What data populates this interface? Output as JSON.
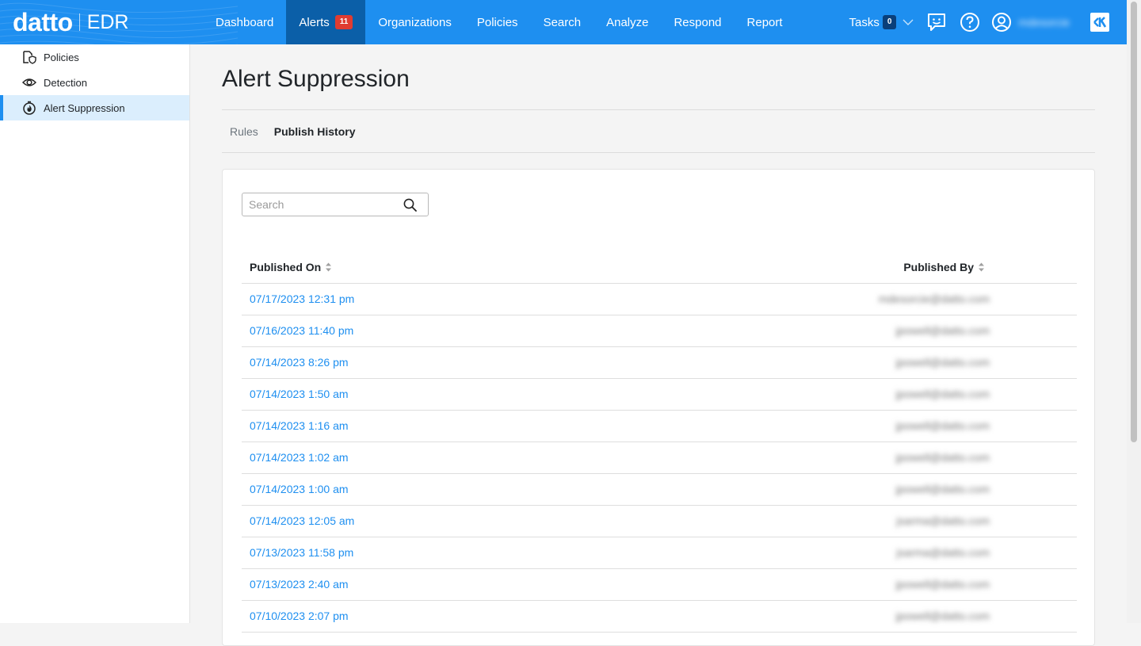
{
  "app": {
    "brand": "datto",
    "product": "EDR"
  },
  "nav": {
    "items": [
      {
        "label": "Dashboard"
      },
      {
        "label": "Alerts",
        "badge": "11"
      },
      {
        "label": "Organizations"
      },
      {
        "label": "Policies"
      },
      {
        "label": "Search"
      },
      {
        "label": "Analyze"
      },
      {
        "label": "Respond"
      },
      {
        "label": "Report"
      }
    ],
    "tasks_label": "Tasks",
    "tasks_count": "0",
    "user_name": "mdesorcie"
  },
  "sidebar": {
    "items": [
      {
        "label": "Policies",
        "icon": "policy-shield-icon"
      },
      {
        "label": "Detection",
        "icon": "eye-icon"
      },
      {
        "label": "Alert Suppression",
        "icon": "suppression-icon"
      }
    ]
  },
  "page": {
    "title": "Alert Suppression",
    "tabs": [
      {
        "label": "Rules"
      },
      {
        "label": "Publish History"
      }
    ]
  },
  "search": {
    "placeholder": "Search"
  },
  "table": {
    "columns": {
      "published_on": "Published On",
      "published_by": "Published By"
    },
    "rows": [
      {
        "date": "07/17/2023 12:31 pm",
        "by": "mdesorcie@datto.com"
      },
      {
        "date": "07/16/2023 11:40 pm",
        "by": "jpowell@datto.com"
      },
      {
        "date": "07/14/2023 8:26 pm",
        "by": "jpowell@datto.com"
      },
      {
        "date": "07/14/2023 1:50 am",
        "by": "jpowell@datto.com"
      },
      {
        "date": "07/14/2023 1:16 am",
        "by": "jpowell@datto.com"
      },
      {
        "date": "07/14/2023 1:02 am",
        "by": "jpowell@datto.com"
      },
      {
        "date": "07/14/2023 1:00 am",
        "by": "jpowell@datto.com"
      },
      {
        "date": "07/14/2023 12:05 am",
        "by": "jsarma@datto.com"
      },
      {
        "date": "07/13/2023 11:58 pm",
        "by": "jsarma@datto.com"
      },
      {
        "date": "07/13/2023 2:40 am",
        "by": "jpowell@datto.com"
      },
      {
        "date": "07/10/2023 2:07 pm",
        "by": "jpowell@datto.com"
      }
    ]
  },
  "colors": {
    "nav_bg": "#1e8ff0",
    "nav_active": "#0b5fa8",
    "link": "#1e8ff0",
    "alert_badge": "#e03c31"
  }
}
